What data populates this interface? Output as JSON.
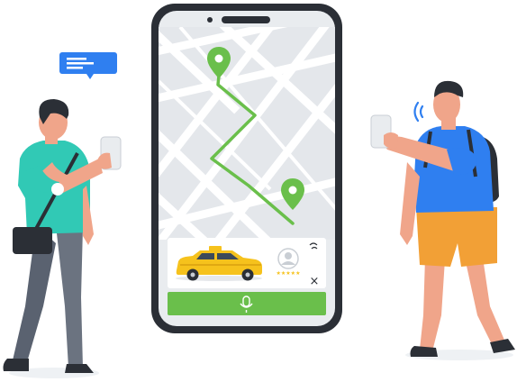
{
  "scene": {
    "type": "taxi-booking-illustration",
    "colors": {
      "map_bg": "#e9ecef",
      "road": "#ffffff",
      "route": "#6abf4b",
      "pin": "#6abf4b",
      "taxi": "#f6c21c",
      "call_bar": "#6abf4b",
      "phone_frame": "#2b2f36",
      "chat_bubble": "#2f7ff0",
      "left_shirt": "#31c9b5",
      "right_shirt": "#2f7ff0",
      "right_shorts": "#f2a036",
      "backpack": "#2b2f36"
    }
  },
  "phone": {
    "driver_card": {
      "stars": "★★★★★",
      "close": "×"
    },
    "call_bar": {
      "icon": "microphone-icon"
    }
  },
  "chat_bubble": {
    "icon": "message-bubble-icon"
  },
  "signal": {
    "icon": "wifi-signal-icon"
  }
}
